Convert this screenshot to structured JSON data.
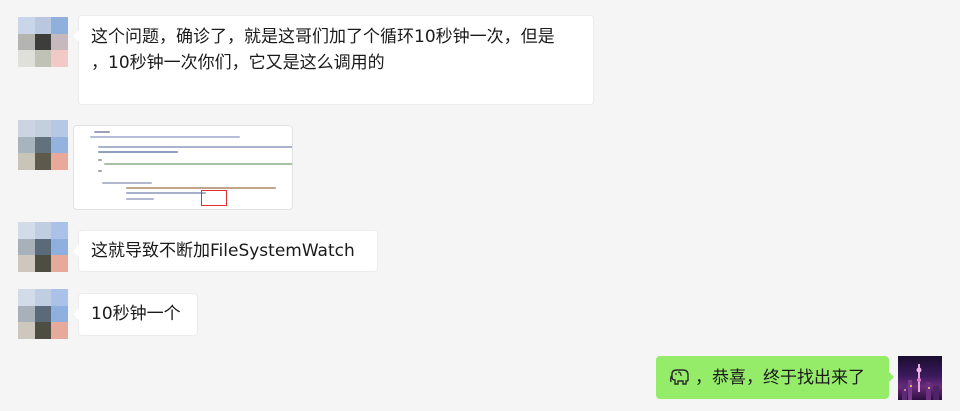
{
  "messages": [
    {
      "text_lines": [
        "这个问题，确诊了，就是这哥们加了个循环10秒钟一次，但是",
        "，10秒钟一次你们，它又是这么调用的"
      ]
    },
    {
      "image": "code-screenshot"
    },
    {
      "text_lines": [
        "这就导致不断加FileSystemWatch"
      ]
    },
    {
      "text_lines": [
        "10秒钟一个"
      ]
    },
    {
      "text_lines": [
        "，恭喜，终于找出来了"
      ],
      "emoji": "elephant-emoji-icon"
    }
  ],
  "colors": {
    "background": "#f5f5f5",
    "bubble_in": "#ffffff",
    "bubble_out": "#95ec69",
    "highlight": "#e0302d"
  }
}
